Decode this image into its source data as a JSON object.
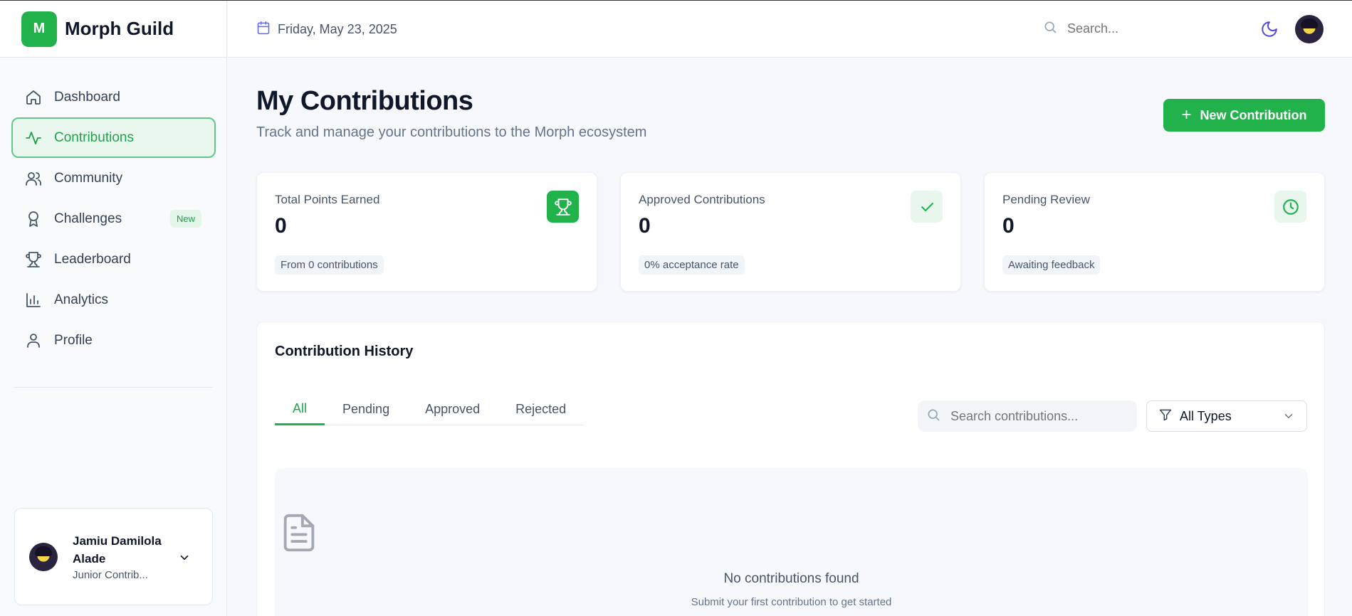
{
  "app": {
    "logo_letter": "M",
    "name": "Morph Guild",
    "brand_color": "#22b24c"
  },
  "sidebar": {
    "items": [
      {
        "label": "Dashboard",
        "icon": "home-icon"
      },
      {
        "label": "Contributions",
        "icon": "activity-icon",
        "active": true
      },
      {
        "label": "Community",
        "icon": "users-icon"
      },
      {
        "label": "Challenges",
        "icon": "award-icon",
        "badge": "New"
      },
      {
        "label": "Leaderboard",
        "icon": "trophy-icon"
      },
      {
        "label": "Analytics",
        "icon": "bar-chart-icon"
      },
      {
        "label": "Profile",
        "icon": "user-icon"
      }
    ],
    "user": {
      "name": "Jamiu Damilola Alade",
      "role": "Junior Contrib..."
    }
  },
  "header": {
    "date": "Friday, May 23, 2025",
    "search_placeholder": "Search..."
  },
  "main": {
    "title": "My Contributions",
    "subtitle": "Track and manage your contributions to the Morph ecosystem",
    "new_button": "New Contribution",
    "stats": [
      {
        "label": "Total Points Earned",
        "value": "0",
        "pill": "From 0 contributions",
        "icon": "trophy-icon"
      },
      {
        "label": "Approved Contributions",
        "value": "0",
        "pill": "0% acceptance rate",
        "icon": "check-icon"
      },
      {
        "label": "Pending Review",
        "value": "0",
        "pill": "Awaiting feedback",
        "icon": "clock-icon"
      }
    ],
    "history": {
      "title": "Contribution History",
      "tabs": [
        "All",
        "Pending",
        "Approved",
        "Rejected"
      ],
      "search_placeholder": "Search contributions...",
      "filter_value": "All Types",
      "empty_title": "No contributions found",
      "empty_subtitle": "Submit your first contribution to get started"
    }
  }
}
